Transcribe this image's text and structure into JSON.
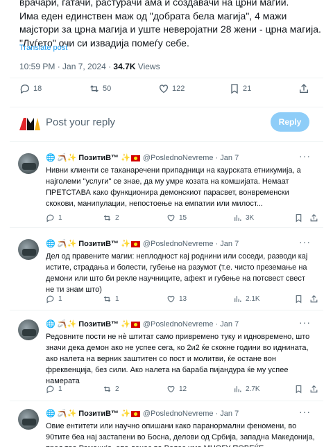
{
  "tweet": {
    "text": "врачари, гатачи, растурачи ама и создавачи на црни магии.\nИма еден единствен маж од \"добрата бела магија\", 4 мажи мајстори за црна магија и уште неверојатни 28 жени - црна магија.\n\"Луѓето\" очи си извадија помеѓу себе.",
    "translate_label": "Translate post",
    "timestamp": "10:59 PM · Jan 7, 2024 · ",
    "views_count": "34.7K",
    "views_label": " Views",
    "replies": "18",
    "reposts": "50",
    "likes": "122",
    "bookmarks": "21"
  },
  "reply_box": {
    "placeholder": "Post your reply",
    "button": "Reply"
  },
  "colors": {
    "accent": "#1d9bf0",
    "reply_button": "#8ecdf8",
    "muted": "#536471"
  },
  "replies": [
    {
      "name": "ПозитиВ™",
      "handle": "@PoslednoNevreme · Jan 7",
      "text": "Нивни клиенти се таканаречени припадници на каурската етникумија, а најголеми \"услуги\" се знае, да му умре козата на комшијата. Немаат ПРЕТСТАВА како функционира демонскиот парасвет, вонвременски скокови, манипулации, непостоење на емпатии или милост...",
      "replies": "1",
      "reposts": "2",
      "likes": "15",
      "views": "3K"
    },
    {
      "name": "ПозитиВ™",
      "handle": "@PoslednoNevreme · Jan 7",
      "text": "Дел од правените магии: неплодност кај роднини или соседи, разводи кај истите, страдања и болести, губење на разумот (т.е. чисто преземање на демони или што би рекле научниците, афект и губење на потсвест свест не ти знам што)",
      "replies": "1",
      "reposts": "1",
      "likes": "13",
      "views": "2.1K"
    },
    {
      "name": "ПозитиВ™",
      "handle": "@PoslednoNevreme · Jan 7",
      "text": "Редовните пости не нѐ штитат само привремено туку и идновремено, што значи дека демон ако не успее сега, ко 2и2 ќе скокне години во иднината, ако налета на верник заштитен со пост и молитви, ќе остане вон фреквенција, без сили. Ако налета на бараба пијандура ќе му успее намерата",
      "replies": "1",
      "reposts": "2",
      "likes": "12",
      "views": "2.7K"
    },
    {
      "name": "ПозитиВ™",
      "handle": "@PoslednoNevreme · Jan 7",
      "text": "Овие ентитети или научно опишани како паранормални феномени, во 90тите беа нај застапени во Босна, делови од Србија, западна Македонија, пред тоа Романија, епа денес во Велес има МНОГУ ПОВЕЌЕ",
      "replies": "",
      "reposts": "",
      "likes": "",
      "views": ""
    }
  ]
}
